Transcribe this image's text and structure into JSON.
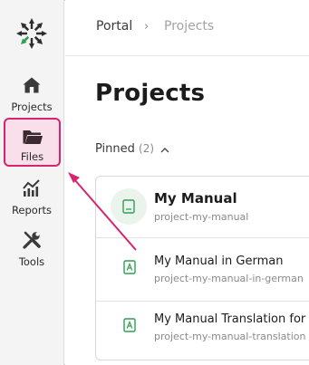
{
  "sidebar": {
    "logo_icon": "asterisk-arrows-logo",
    "items": [
      {
        "label": "Projects",
        "icon": "house-icon"
      },
      {
        "label": "Files",
        "icon": "folder-icon",
        "highlighted": true
      },
      {
        "label": "Reports",
        "icon": "chart-icon"
      },
      {
        "label": "Tools",
        "icon": "wrench-screwdriver-icon"
      }
    ]
  },
  "breadcrumb": {
    "portal": "Portal",
    "separator": "›",
    "current": "Projects"
  },
  "main": {
    "title": "Projects",
    "pinned_label": "Pinned",
    "pinned_count": "(2)",
    "projects": [
      {
        "title": "My Manual",
        "subtitle": "project-my-manual"
      },
      {
        "title": "My Manual in German",
        "subtitle": "project-my-manual-in-german"
      },
      {
        "title": "My Manual Translation for",
        "subtitle": "project-my-manual-translation"
      }
    ]
  },
  "colors": {
    "highlight_border": "#d6246e",
    "highlight_fill": "#f9dfe9",
    "doc_icon_green": "#2f9e4f"
  }
}
